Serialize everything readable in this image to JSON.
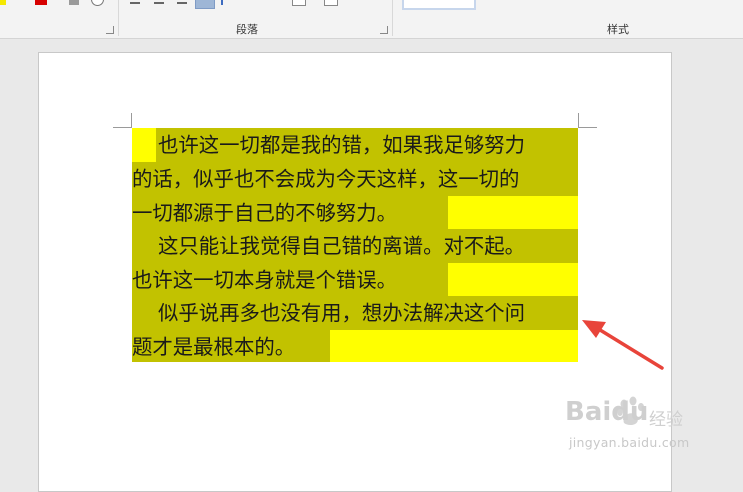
{
  "ribbon": {
    "paragraph_group_label": "段落",
    "styles_group_label": "样式"
  },
  "document": {
    "lines": [
      "也许这一切都是我的错，如果我足够努力",
      "的话，似乎也不会成为今天这样，这一切的",
      "一切都源于自己的不够努力。",
      "这只能让我觉得自己错的离谱。对不起。",
      "也许这一切本身就是个错误。",
      "似乎说再多也没有用，想办法解决这个问",
      "题才是最根本的。"
    ],
    "highlight_colors": {
      "shaded": "#c2c200",
      "highlight": "#ffff00"
    }
  },
  "annotation": {
    "arrow_color": "#e8443a"
  },
  "watermark": {
    "brand": "Baidu",
    "brand_cn": "经验",
    "url": "jingyan.baidu.com"
  }
}
